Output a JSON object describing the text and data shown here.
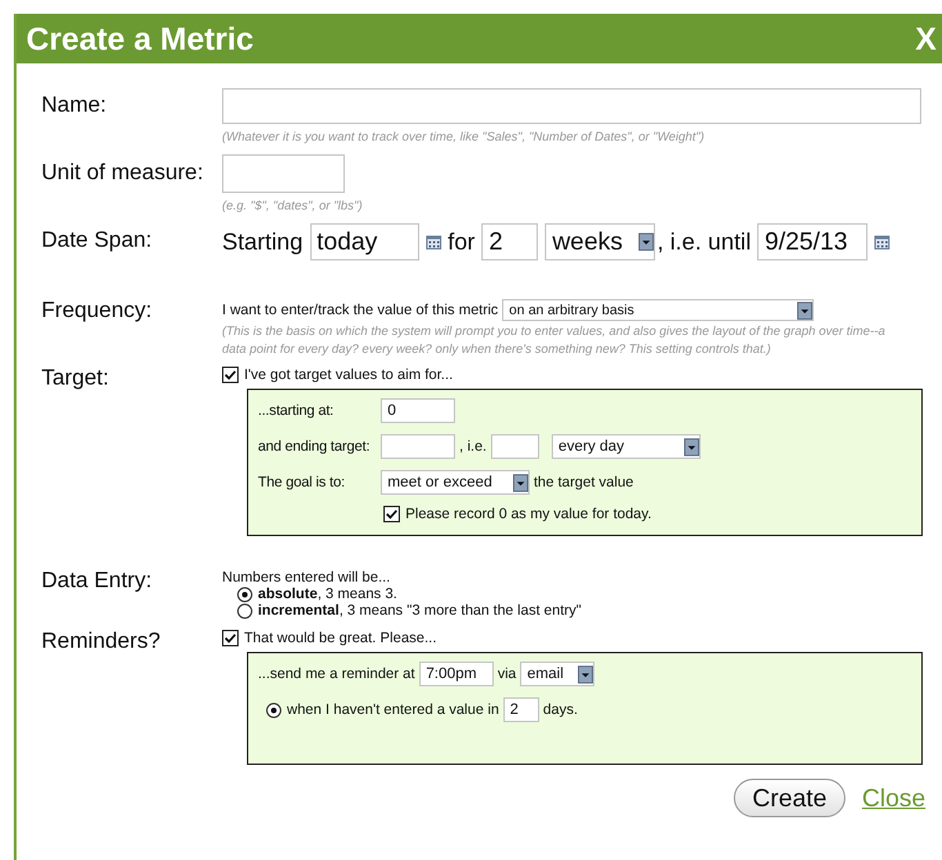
{
  "window": {
    "title": "Create a Metric",
    "close": "X"
  },
  "name": {
    "label": "Name:",
    "hint": "(Whatever it is you want to track over time, like \"Sales\", \"Number of Dates\", or \"Weight\")"
  },
  "unit": {
    "label": "Unit of measure:",
    "hint": "(e.g. \"$\", \"dates\", or \"lbs\")"
  },
  "date_span": {
    "label": "Date Span:",
    "starting": "Starting",
    "start_value": "today",
    "for": "for",
    "count": "2",
    "period": "weeks",
    "until": ", i.e. until",
    "end_value": "9/25/13"
  },
  "frequency": {
    "label": "Frequency:",
    "prompt": "I want to enter/track the value of this metric",
    "value": "on an arbitrary basis",
    "hint": "(This is the basis on which the system will prompt you to enter values, and also gives the layout of the graph over time--a data point for every day? every week? only when there's something new? This setting controls that.)"
  },
  "target": {
    "label": "Target:",
    "checkbox": {
      "label": "I've got target values to aim for...",
      "checked": true
    },
    "starting_label": "...starting at:",
    "starting_value": "0",
    "ending_label": "and ending target:",
    "ie": ", i.e.",
    "every": "every day",
    "goal_label": "The goal is to:",
    "goal": "meet or exceed",
    "goal_suffix": "the target value",
    "record": {
      "label": "Please record 0 as my value for today.",
      "checked": true
    }
  },
  "data_entry": {
    "label": "Data Entry:",
    "intro": "Numbers entered will be...",
    "options": [
      {
        "text": "**absolute**, 3 means 3.",
        "selected": true
      },
      {
        "text": "**incremental**, 3 means \"3 more than the last entry\"",
        "selected": false
      }
    ]
  },
  "reminders": {
    "label": "Reminders?",
    "checkbox": {
      "label": "That would be great. Please...",
      "checked": true
    },
    "send_label": "...send me a reminder at",
    "time": "7:00pm",
    "via": "via",
    "channel": "email",
    "when": {
      "label": "when I haven't entered a value in",
      "selected": true
    },
    "days_value": "2",
    "days": "days."
  },
  "buttons": {
    "create": "Create",
    "close": "Close"
  }
}
